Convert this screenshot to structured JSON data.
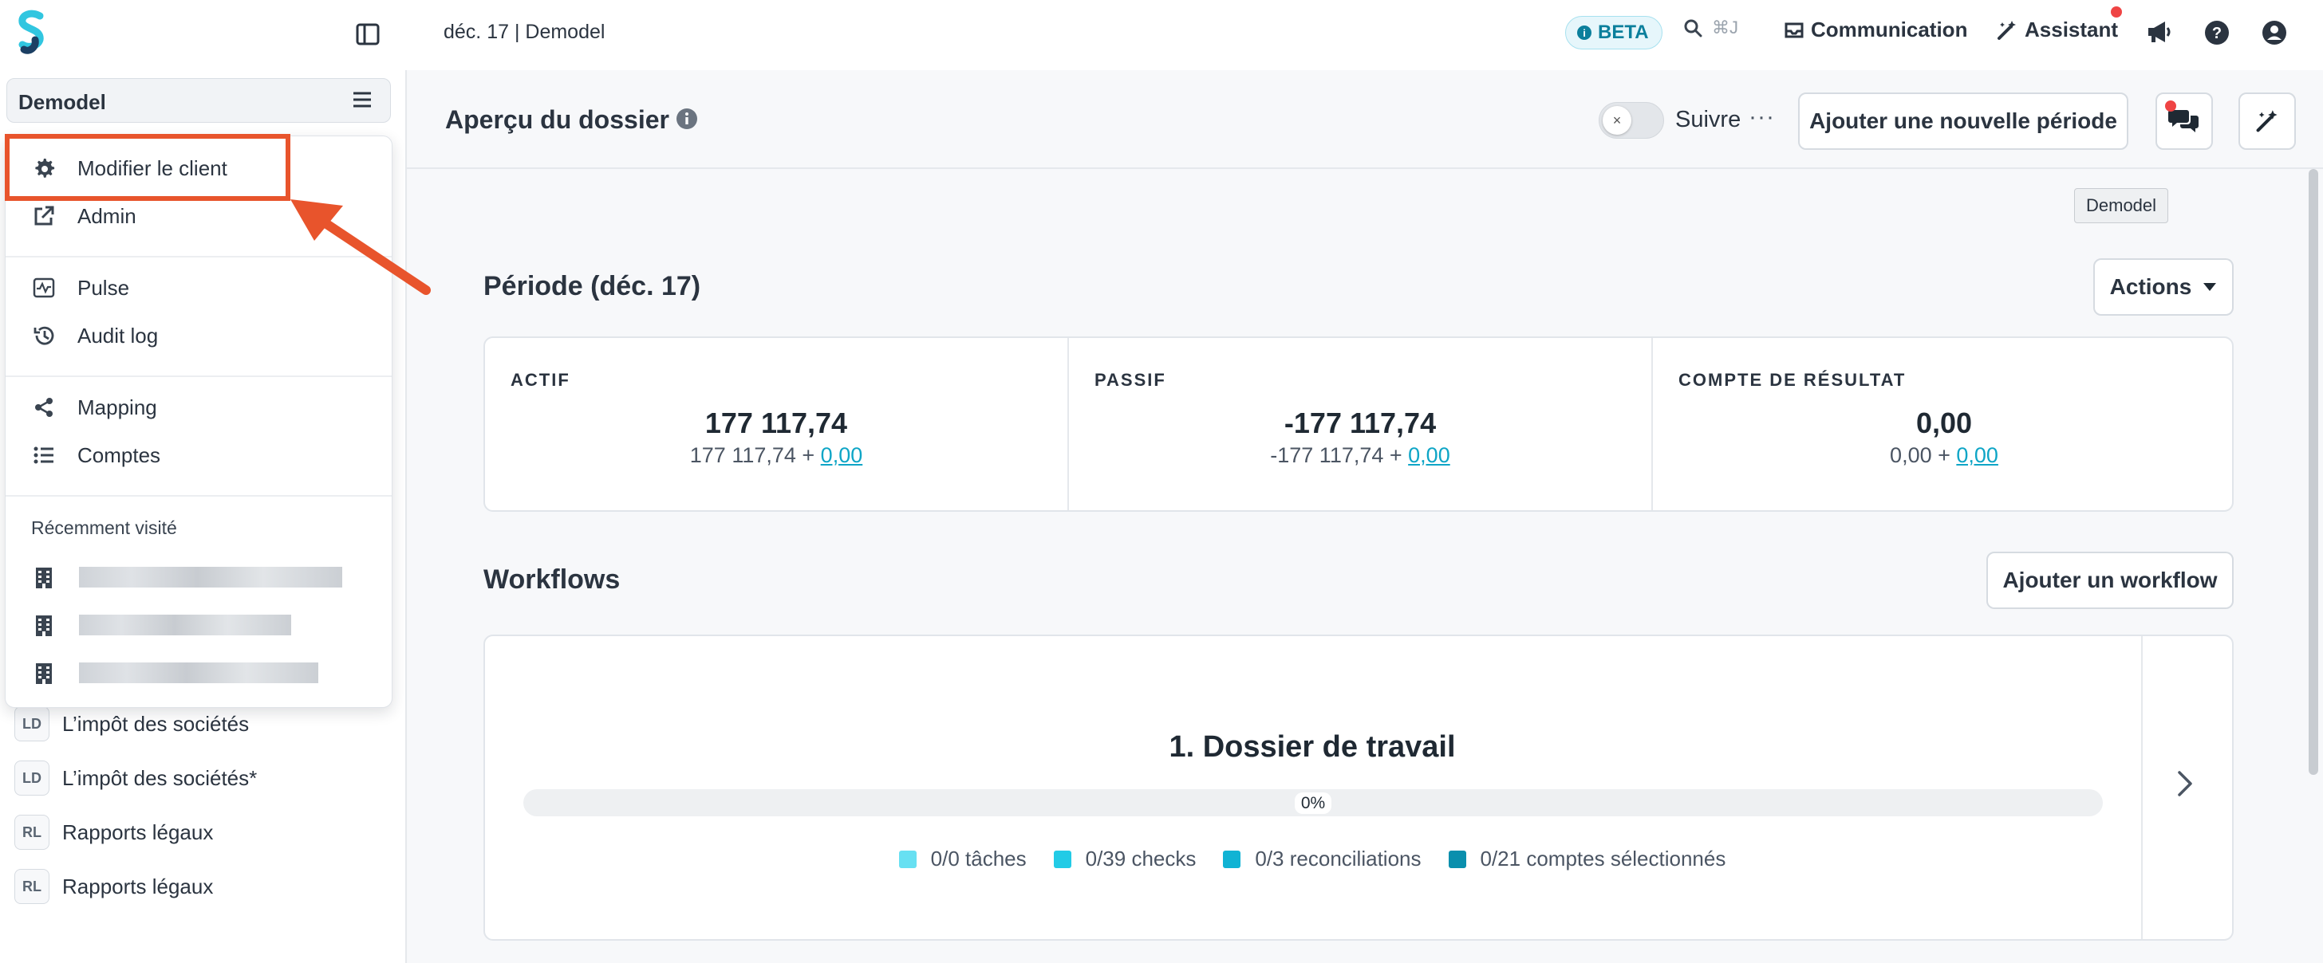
{
  "topbar": {
    "breadcrumb": "déc. 17 | Demodel",
    "beta_label": "BETA",
    "search_shortcut": "⌘J",
    "communication_label": "Communication",
    "assistant_label": "Assistant"
  },
  "sidebar": {
    "client_name": "Demodel",
    "items": [
      {
        "badge": "LD",
        "label": "L’impôt des sociétés"
      },
      {
        "badge": "LD",
        "label": "L’impôt des sociétés*"
      },
      {
        "badge": "RL",
        "label": "Rapports légaux"
      },
      {
        "badge": "RL",
        "label": "Rapports légaux"
      }
    ]
  },
  "dropdown": {
    "items": [
      {
        "label": "Modifier le client",
        "icon": "gear-icon"
      },
      {
        "label": "Admin",
        "icon": "external-link-icon"
      },
      {
        "label": "Pulse",
        "icon": "pulse-icon"
      },
      {
        "label": "Audit log",
        "icon": "history-icon"
      },
      {
        "label": "Mapping",
        "icon": "share-icon"
      },
      {
        "label": "Comptes",
        "icon": "list-icon"
      }
    ],
    "recent_heading": "Récemment visité"
  },
  "header": {
    "title": "Aperçu du dossier",
    "follow_label": "Suivre",
    "more_label": "···",
    "add_period_label": "Ajouter une nouvelle période",
    "tooltip": "Demodel"
  },
  "period": {
    "title": "Période (déc. 17)",
    "actions_label": "Actions",
    "columns": [
      {
        "label": "ACTIF",
        "value": "177 117,74",
        "sub_base": "177 117,74 + ",
        "sub_link": "0,00"
      },
      {
        "label": "PASSIF",
        "value": "-177 117,74",
        "sub_base": "-177 117,74 + ",
        "sub_link": "0,00"
      },
      {
        "label": "COMPTE DE RÉSULTAT",
        "value": "0,00",
        "sub_base": "0,00 + ",
        "sub_link": "0,00"
      }
    ]
  },
  "workflows": {
    "title": "Workflows",
    "add_label": "Ajouter un workflow",
    "card": {
      "title": "1. Dossier de travail",
      "progress_label": "0%",
      "progress": 0,
      "legend": [
        {
          "label": "0/0 tâches",
          "color": "#67e0f2"
        },
        {
          "label": "0/39 checks",
          "color": "#22cbe6"
        },
        {
          "label": "0/3 reconciliations",
          "color": "#10b3d4"
        },
        {
          "label": "0/21 comptes sélectionnés",
          "color": "#0a8fad"
        }
      ]
    }
  },
  "colors": {
    "accent": "#0ea5c6",
    "highlight": "#e8542c",
    "notification": "#ef4444"
  }
}
